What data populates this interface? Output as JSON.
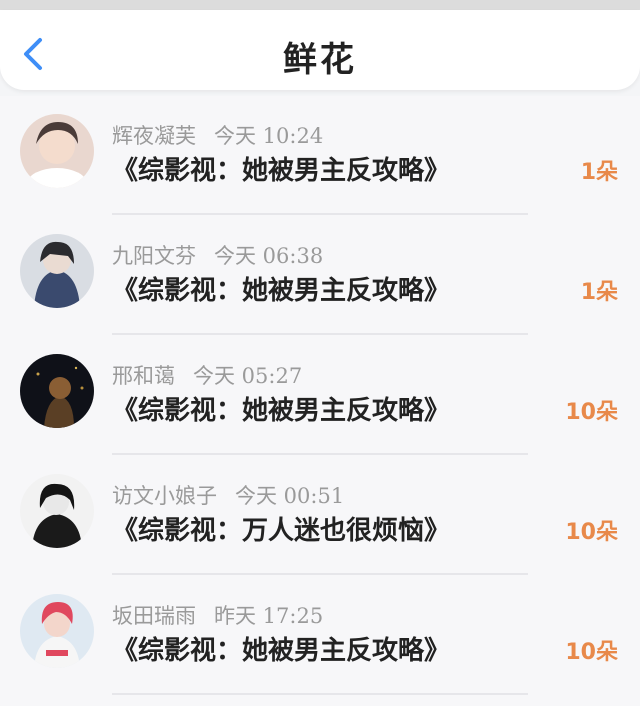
{
  "header": {
    "title": "鲜花",
    "back_icon": "chevron-left-icon",
    "accent_color": "#3e8ef7"
  },
  "flowers": [
    {
      "name": "辉夜凝芙",
      "time": "今天 10:24",
      "book": "《综影视：她被男主反攻略》",
      "count": "1朵"
    },
    {
      "name": "九阳文芬",
      "time": "今天 06:38",
      "book": "《综影视：她被男主反攻略》",
      "count": "1朵"
    },
    {
      "name": "邢和蔼",
      "time": "今天 05:27",
      "book": "《综影视：她被男主反攻略》",
      "count": "10朵"
    },
    {
      "name": "访文小娘子",
      "time": "今天 00:51",
      "book": "《综影视：万人迷也很烦恼》",
      "count": "10朵"
    },
    {
      "name": "坂田瑞雨",
      "time": "昨天 17:25",
      "book": "《综影视：她被男主反攻略》",
      "count": "10朵"
    }
  ],
  "count_color": "#e8894a"
}
